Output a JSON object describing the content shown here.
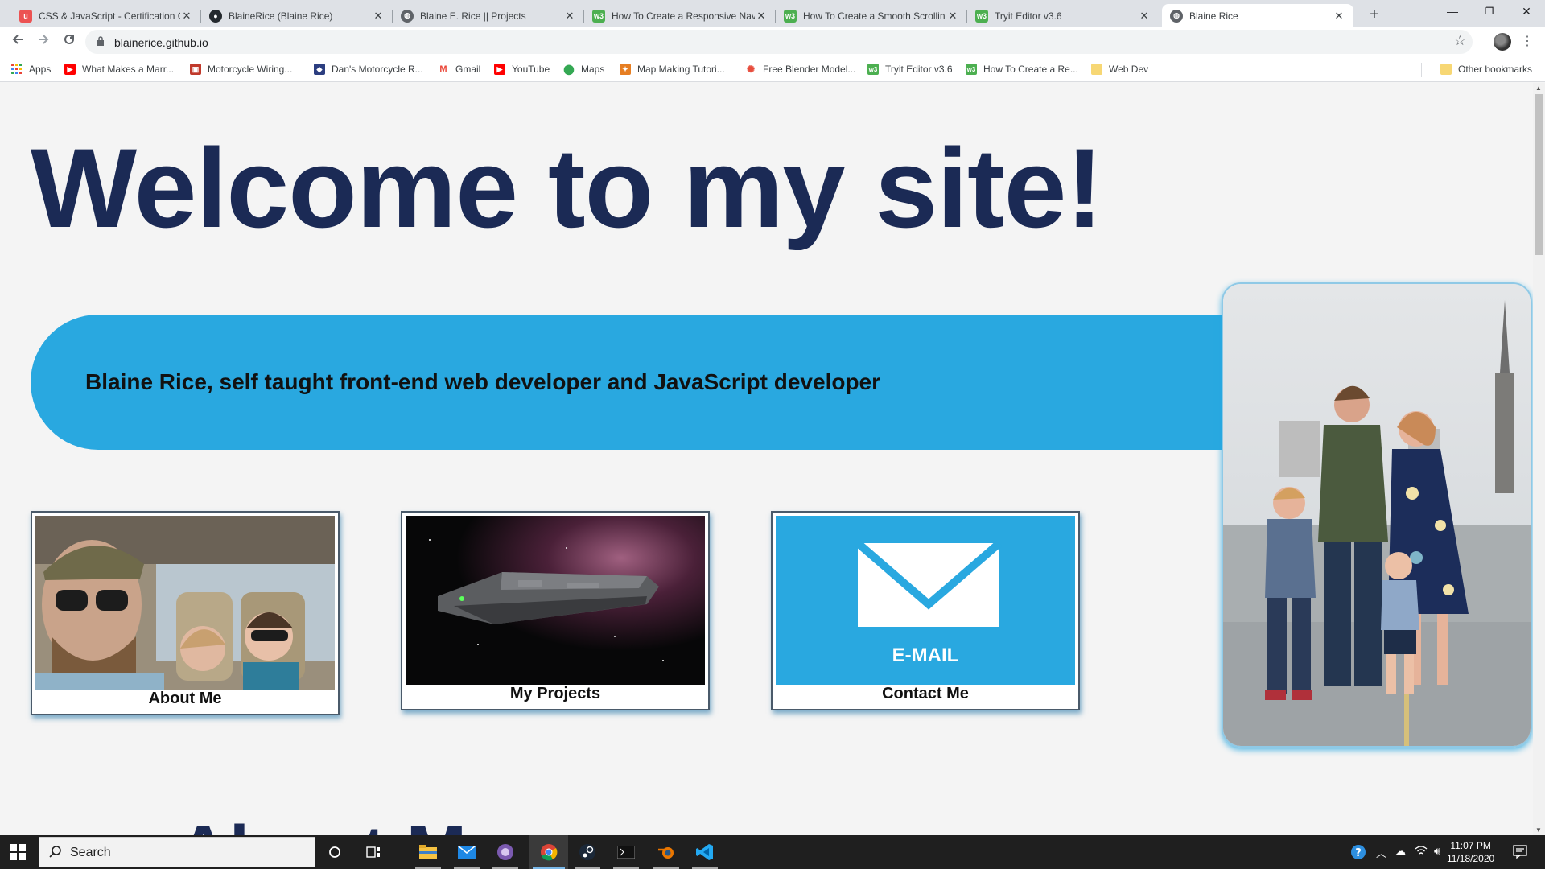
{
  "browser": {
    "tabs": [
      {
        "title": "CSS & JavaScript - Certification C",
        "favicon": "udemy-icon",
        "active": false
      },
      {
        "title": "BlaineRice (Blaine Rice)",
        "favicon": "github-icon",
        "active": false
      },
      {
        "title": "Blaine E. Rice || Projects",
        "favicon": "globe-icon",
        "active": false
      },
      {
        "title": "How To Create a Responsive Nav",
        "favicon": "w3schools-icon",
        "active": false
      },
      {
        "title": "How To Create a Smooth Scrollin",
        "favicon": "w3schools-icon",
        "active": false
      },
      {
        "title": "Tryit Editor v3.6",
        "favicon": "w3schools-icon",
        "active": false
      },
      {
        "title": "Blaine Rice",
        "favicon": "globe-icon",
        "active": true
      }
    ],
    "new_tab_label": "+",
    "window_controls": {
      "minimize": "—",
      "maximize": "❐",
      "close": "✕"
    },
    "address": "blainerice.github.io",
    "bookmarks": [
      {
        "label": "Apps",
        "icon": "apps-grid-icon"
      },
      {
        "label": "What Makes a Marr...",
        "icon": "youtube-icon"
      },
      {
        "label": "Motorcycle Wiring...",
        "icon": "image-icon"
      },
      {
        "label": "Dan's Motorcycle R...",
        "icon": "site-icon"
      },
      {
        "label": "Gmail",
        "icon": "gmail-icon"
      },
      {
        "label": "YouTube",
        "icon": "youtube-icon"
      },
      {
        "label": "Maps",
        "icon": "maps-icon"
      },
      {
        "label": "Map Making Tutori...",
        "icon": "site-icon"
      },
      {
        "label": "Free Blender Model...",
        "icon": "site-icon"
      },
      {
        "label": "Tryit Editor v3.6",
        "icon": "w3schools-icon"
      },
      {
        "label": "How To Create a Re...",
        "icon": "w3schools-icon"
      },
      {
        "label": "Web Dev",
        "icon": "folder-icon"
      }
    ],
    "other_bookmarks": "Other bookmarks"
  },
  "page": {
    "heading": "Welcome to my site!",
    "tagline": "Blaine Rice, self taught front-end web developer and JavaScript developer",
    "cards": [
      {
        "caption": "About Me"
      },
      {
        "caption": "My Projects"
      },
      {
        "caption": "Contact Me",
        "image_text": "E-MAIL"
      }
    ],
    "next_heading": "About Me",
    "accent_color": "#29a8e0",
    "heading_color": "#1b2a55"
  },
  "taskbar": {
    "search_label": "Search",
    "time": "11:07 PM",
    "date": "11/18/2020"
  }
}
